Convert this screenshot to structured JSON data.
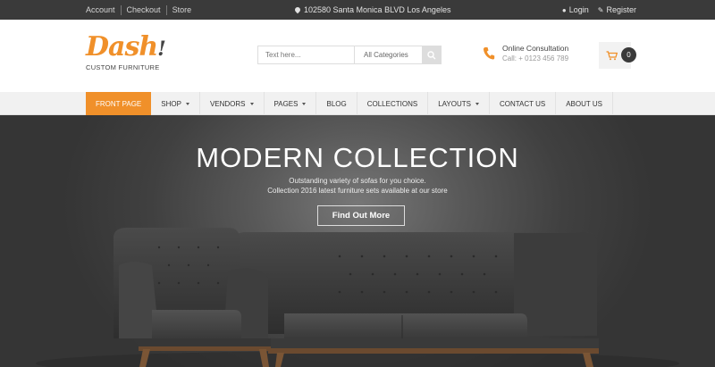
{
  "topbar": {
    "links": [
      "Account",
      "Checkout",
      "Store"
    ],
    "address": "102580 Santa Monica BLVD Los Angeles",
    "login": "Login",
    "register": "Register"
  },
  "header": {
    "logo_mark": "Dash",
    "logo_bang": "!",
    "logo_sub": "CUSTOM FURNITURE",
    "search_placeholder": "Text here...",
    "search_category": "All Categories",
    "consult_title": "Online Consultation",
    "consult_phone": "Call: + 0123 456 789",
    "cart_count": "0"
  },
  "nav": {
    "items": [
      "FRONT PAGE",
      "SHOP",
      "VENDORS",
      "PAGES",
      "BLOG",
      "COLLECTIONS",
      "LAYOUTS",
      "CONTACT US",
      "ABOUT US"
    ]
  },
  "hero": {
    "title": "MODERN COLLECTION",
    "line1": "Outstanding variety of sofas for you choice.",
    "line2": "Collection 2016 latest furniture sets available at our store",
    "cta": "Find Out More"
  },
  "colors": {
    "accent": "#f0902a",
    "topbar": "#3a3a3a",
    "nav_bg": "#f1f1f1"
  }
}
